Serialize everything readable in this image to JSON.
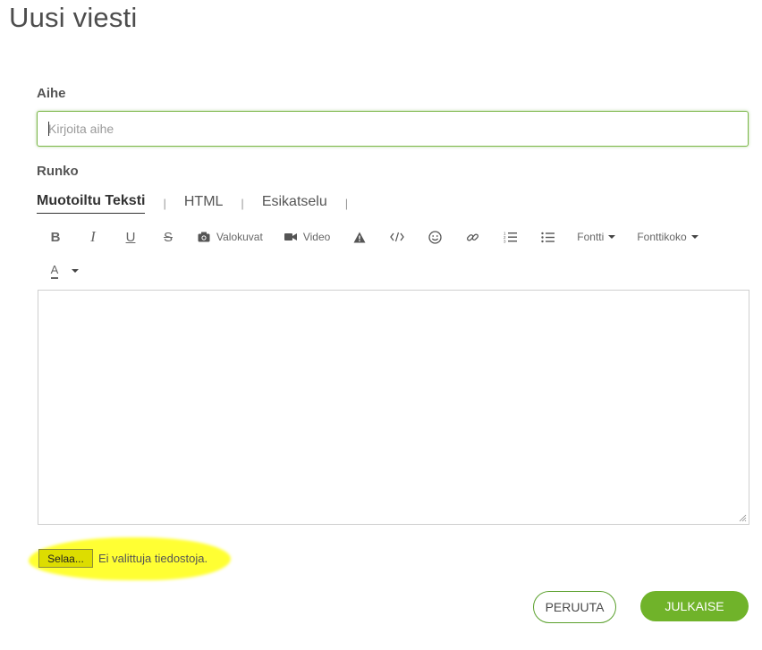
{
  "page": {
    "title": "Uusi viesti"
  },
  "subject": {
    "label": "Aihe",
    "placeholder": "Kirjoita aihe",
    "value": ""
  },
  "body": {
    "label": "Runko",
    "tabs": [
      {
        "label": "Muotoiltu Teksti",
        "active": true
      },
      {
        "label": "HTML",
        "active": false
      },
      {
        "label": "Esikatselu",
        "active": false
      }
    ],
    "separator": "|"
  },
  "toolbar": {
    "bold": "B",
    "italic": "I",
    "underline": "U",
    "strike": "S",
    "photos_label": "Valokuvat",
    "video_label": "Video",
    "font_label": "Fontti",
    "font_size_label": "Fonttikoko",
    "text_color_label": "A",
    "icons": [
      "bold-icon",
      "italic-icon",
      "underline-icon",
      "strikethrough-icon",
      "camera-icon",
      "video-camera-icon",
      "warning-icon",
      "code-icon",
      "smiley-icon",
      "link-icon",
      "ordered-list-icon",
      "bullet-list-icon",
      "chevron-down-icon",
      "text-color-icon"
    ]
  },
  "attachment": {
    "browse_label": "Selaa...",
    "status": "Ei valittuja tiedostoja."
  },
  "actions": {
    "cancel_label": "PERUUTA",
    "publish_label": "JULKAISE"
  },
  "colors": {
    "accent": "#70b32a",
    "accent_border": "#5aa02c",
    "highlight": "#ffff33"
  }
}
